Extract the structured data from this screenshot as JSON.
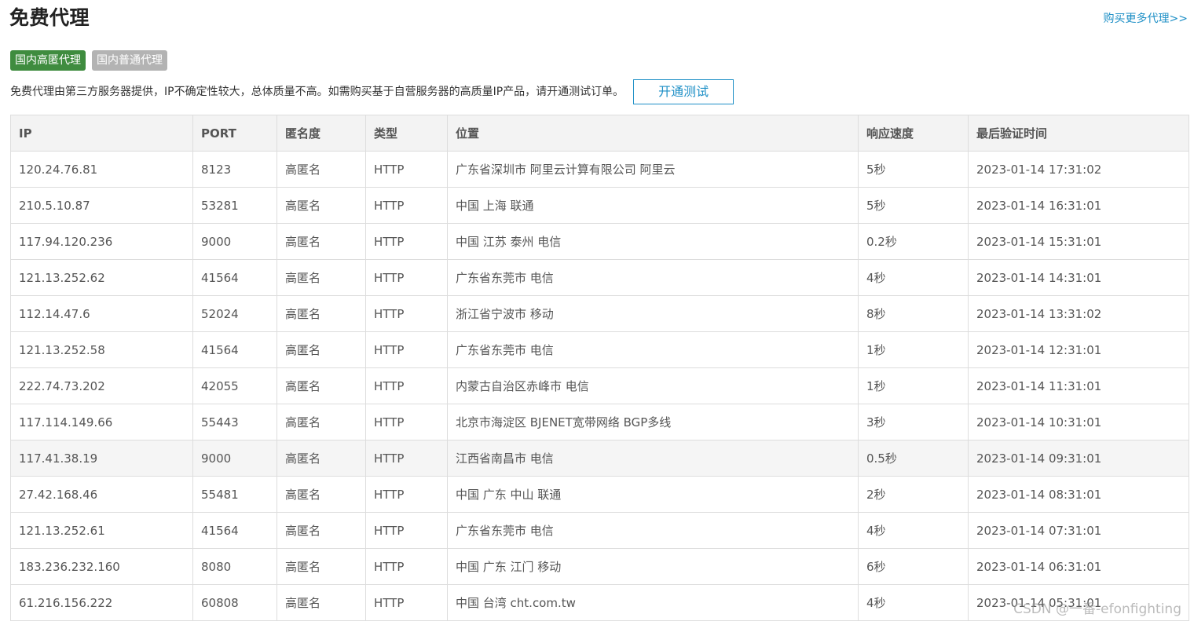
{
  "header": {
    "title": "免费代理",
    "more_link": "购买更多代理>>"
  },
  "tabs": [
    {
      "label": "国内高匿代理",
      "active": true
    },
    {
      "label": "国内普通代理",
      "active": false
    }
  ],
  "notice": {
    "text": "免费代理由第三方服务器提供，IP不确定性较大，总体质量不高。如需购买基于自营服务器的高质量IP产品，请开通测试订单。",
    "button_label": "开通测试"
  },
  "table": {
    "columns": [
      "IP",
      "PORT",
      "匿名度",
      "类型",
      "位置",
      "响应速度",
      "最后验证时间"
    ],
    "rows": [
      {
        "ip": "120.24.76.81",
        "port": "8123",
        "anon": "高匿名",
        "type": "HTTP",
        "location": "广东省深圳市 阿里云计算有限公司 阿里云",
        "speed": "5秒",
        "time": "2023-01-14 17:31:02"
      },
      {
        "ip": "210.5.10.87",
        "port": "53281",
        "anon": "高匿名",
        "type": "HTTP",
        "location": "中国 上海 联通",
        "speed": "5秒",
        "time": "2023-01-14 16:31:01"
      },
      {
        "ip": "117.94.120.236",
        "port": "9000",
        "anon": "高匿名",
        "type": "HTTP",
        "location": "中国 江苏 泰州 电信",
        "speed": "0.2秒",
        "time": "2023-01-14 15:31:01"
      },
      {
        "ip": "121.13.252.62",
        "port": "41564",
        "anon": "高匿名",
        "type": "HTTP",
        "location": "广东省东莞市 电信",
        "speed": "4秒",
        "time": "2023-01-14 14:31:01"
      },
      {
        "ip": "112.14.47.6",
        "port": "52024",
        "anon": "高匿名",
        "type": "HTTP",
        "location": "浙江省宁波市 移动",
        "speed": "8秒",
        "time": "2023-01-14 13:31:02"
      },
      {
        "ip": "121.13.252.58",
        "port": "41564",
        "anon": "高匿名",
        "type": "HTTP",
        "location": "广东省东莞市 电信",
        "speed": "1秒",
        "time": "2023-01-14 12:31:01"
      },
      {
        "ip": "222.74.73.202",
        "port": "42055",
        "anon": "高匿名",
        "type": "HTTP",
        "location": "内蒙古自治区赤峰市 电信",
        "speed": "1秒",
        "time": "2023-01-14 11:31:01"
      },
      {
        "ip": "117.114.149.66",
        "port": "55443",
        "anon": "高匿名",
        "type": "HTTP",
        "location": "北京市海淀区 BJENET宽带网络 BGP多线",
        "speed": "3秒",
        "time": "2023-01-14 10:31:01"
      },
      {
        "ip": "117.41.38.19",
        "port": "9000",
        "anon": "高匿名",
        "type": "HTTP",
        "location": "江西省南昌市 电信",
        "speed": "0.5秒",
        "time": "2023-01-14 09:31:01"
      },
      {
        "ip": "27.42.168.46",
        "port": "55481",
        "anon": "高匿名",
        "type": "HTTP",
        "location": "中国 广东 中山 联通",
        "speed": "2秒",
        "time": "2023-01-14 08:31:01"
      },
      {
        "ip": "121.13.252.61",
        "port": "41564",
        "anon": "高匿名",
        "type": "HTTP",
        "location": "广东省东莞市 电信",
        "speed": "4秒",
        "time": "2023-01-14 07:31:01"
      },
      {
        "ip": "183.236.232.160",
        "port": "8080",
        "anon": "高匿名",
        "type": "HTTP",
        "location": "中国 广东 江门 移动",
        "speed": "6秒",
        "time": "2023-01-14 06:31:01"
      },
      {
        "ip": "61.216.156.222",
        "port": "60808",
        "anon": "高匿名",
        "type": "HTTP",
        "location": "中国 台湾 cht.com.tw",
        "speed": "4秒",
        "time": "2023-01-14 05:31:01"
      }
    ]
  },
  "watermark": "CSDN @一番-efonfighting"
}
